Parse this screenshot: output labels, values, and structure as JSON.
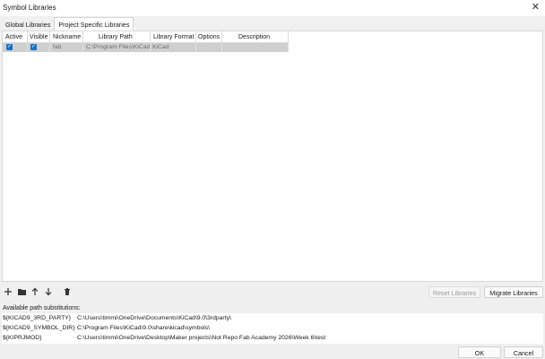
{
  "window": {
    "title": "Symbol Libraries",
    "close_glyph": "✕"
  },
  "tabs": [
    {
      "label": "Global Libraries",
      "selected": false
    },
    {
      "label": "Project Specific Libraries",
      "selected": true
    }
  ],
  "table": {
    "columns": [
      "Active",
      "Visible",
      "Nickname",
      "Library Path",
      "Library Format",
      "Options",
      "Description"
    ],
    "rows": [
      {
        "active": true,
        "visible": true,
        "nickname": "fab",
        "path": "C:\\Program Files\\KiCad",
        "format": "KiCad",
        "options": "",
        "description": ""
      }
    ]
  },
  "toolbar": {
    "icons": [
      "add-icon",
      "folder-icon",
      "move-up-icon",
      "move-down-icon",
      "trash-icon"
    ]
  },
  "buttons": {
    "reset": "Reset Libraries",
    "migrate": "Migrate Libraries",
    "ok": "OK",
    "cancel": "Cancel"
  },
  "substitutions": {
    "label": "Available path substitutions:",
    "rows": [
      {
        "name": "${KICAD9_3RD_PARTY}",
        "value": "C:\\Users\\timmi\\OneDrive\\Documents\\KiCad\\9.0\\3rdparty\\"
      },
      {
        "name": "${KICAD9_SYMBOL_DIR}",
        "value": "C:\\Program Files\\KiCad\\9.0\\share\\kicad\\symbols\\"
      },
      {
        "name": "${KIPRJMOD}",
        "value": "C:\\Users\\timmi\\OneDrive\\Desktop\\Maker projects\\Not Repo Fab Academy 2026\\Week 6\\test"
      }
    ]
  },
  "colors": {
    "checkbox": "#1a73c8",
    "selected_row": "#cfcfcf"
  }
}
